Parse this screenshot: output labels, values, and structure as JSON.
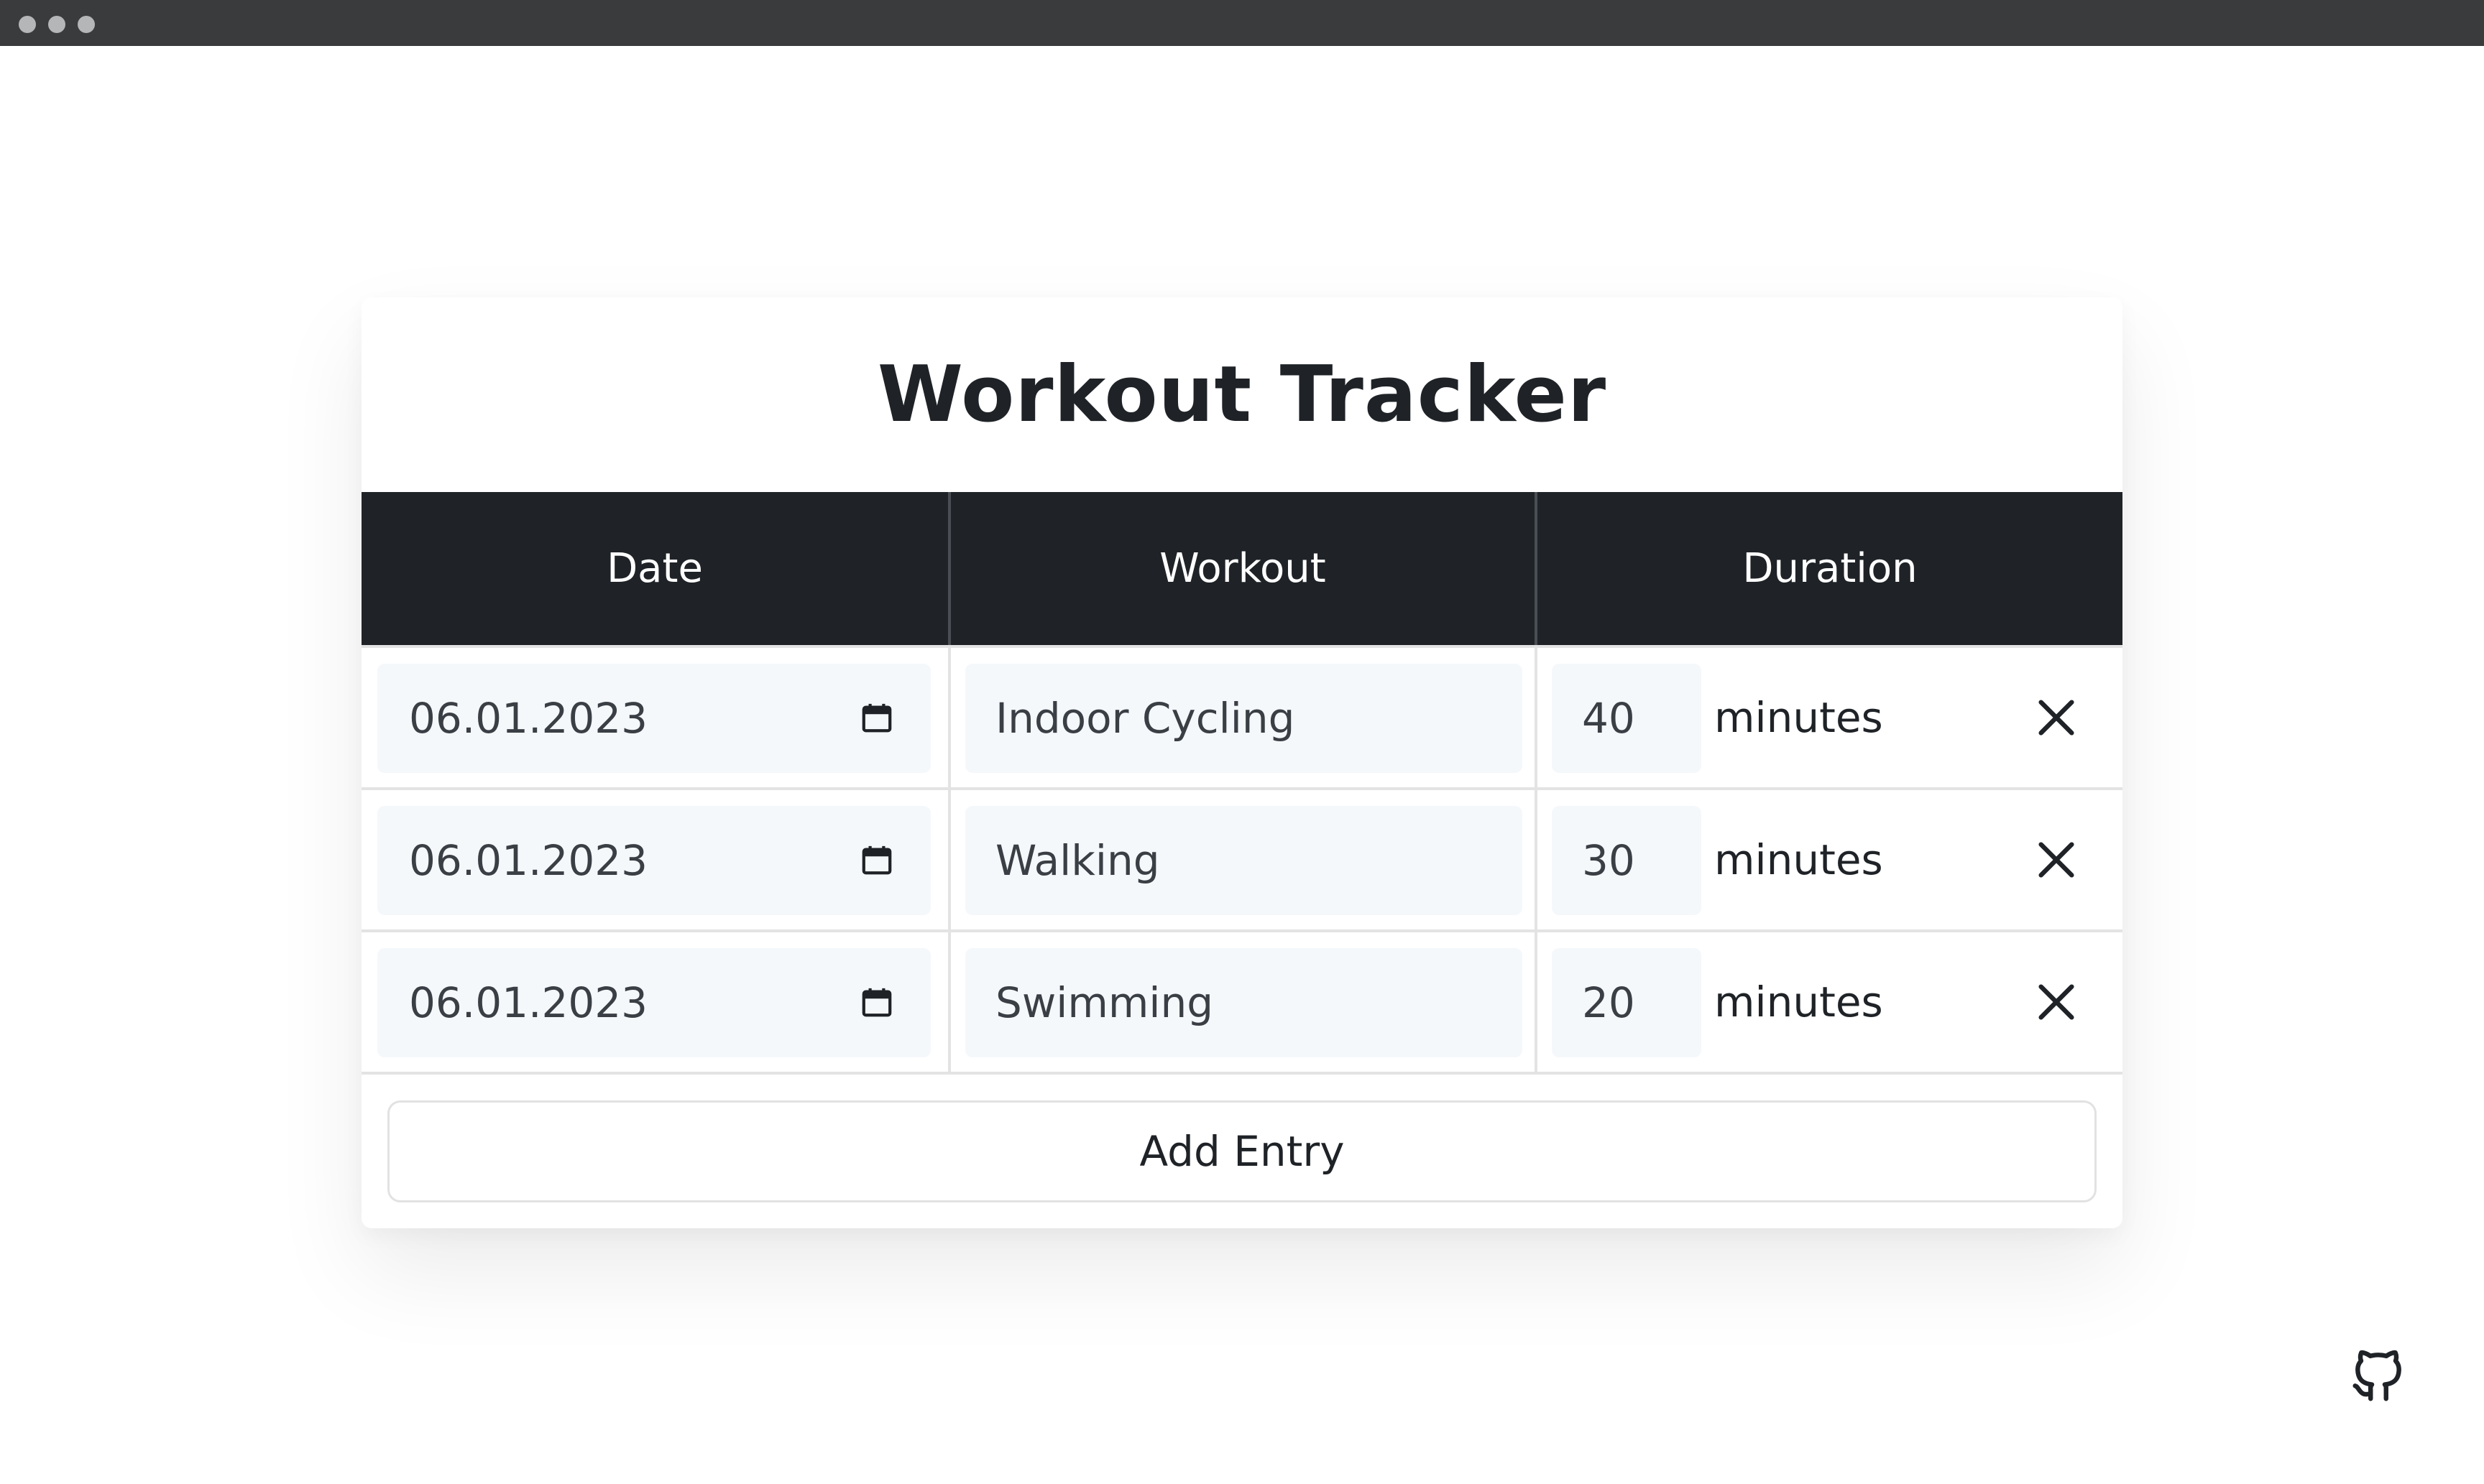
{
  "app": {
    "title": "Workout Tracker"
  },
  "table": {
    "headers": [
      "Date",
      "Workout",
      "Duration"
    ],
    "rows": [
      {
        "date": "06.01.2023",
        "workout": "Indoor Cycling",
        "duration": "40",
        "unit": "minutes"
      },
      {
        "date": "06.01.2023",
        "workout": "Walking",
        "duration": "30",
        "unit": "minutes"
      },
      {
        "date": "06.01.2023",
        "workout": "Swimming",
        "duration": "20",
        "unit": "minutes"
      }
    ]
  },
  "actions": {
    "add_label": "Add Entry"
  },
  "icons": {
    "calendar": "calendar-icon",
    "remove": "close-icon",
    "github": "github-icon"
  },
  "colors": {
    "header_bg": "#1f2327",
    "field_bg": "#f5f8fb",
    "window_bar": "#3a3b3d"
  }
}
